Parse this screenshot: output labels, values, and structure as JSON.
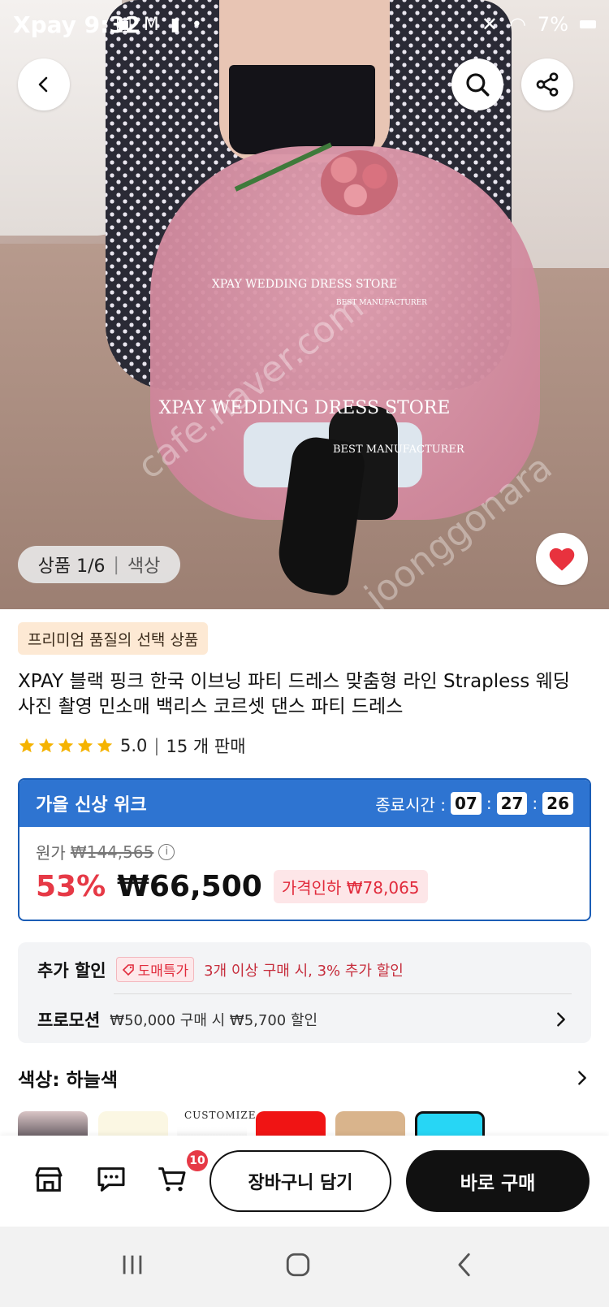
{
  "status_bar": {
    "app_label": "Xpay",
    "time": "9:32",
    "battery": "7%"
  },
  "hero": {
    "watermark_main": "XPAY WEDDING DRESS STORE",
    "watermark_sub": "BEST MANUFACTURER",
    "watermark_diag_1": "cafe.naver.com",
    "watermark_diag_2": "joonggonara",
    "counter": "상품 1/6",
    "counter_tab": "색상"
  },
  "product": {
    "badge": "프리미엄 품질의 선택 상품",
    "title": "XPAY 블랙 핑크 한국 이브닝 파티 드레스 맞춤형 라인 Strapless 웨딩 사진 촬영 민소매 백리스 코르셋 댄스 파티 드레스",
    "rating": "5.0",
    "sold": "15 개 판매"
  },
  "sale": {
    "name": "가을 신상 위크",
    "timer_label": "종료시간 :",
    "hours": "07",
    "minutes": "27",
    "seconds": "26",
    "orig_label": "원가",
    "orig_price": "₩144,565",
    "discount_pct": "53%",
    "price": "₩66,500",
    "price_drop": "가격인하 ₩78,065"
  },
  "discounts": {
    "extra_label": "추가 할인",
    "wholesale_tag": "도매특가",
    "wholesale_text": "3개 이상 구매 시, 3% 추가 할인",
    "promo_label": "프로모션",
    "promo_text": "₩50,000 구매 시 ₩5,700 할인"
  },
  "color": {
    "label": "색상: 하늘색",
    "custom_label": "CUSTOMIZE"
  },
  "actions": {
    "cart_count": "10",
    "add_to_cart": "장바구니 담기",
    "buy_now": "바로 구매"
  },
  "colors": {
    "accent_blue": "#2e74d1",
    "sale_red": "#e63946",
    "star": "#f5b301"
  }
}
